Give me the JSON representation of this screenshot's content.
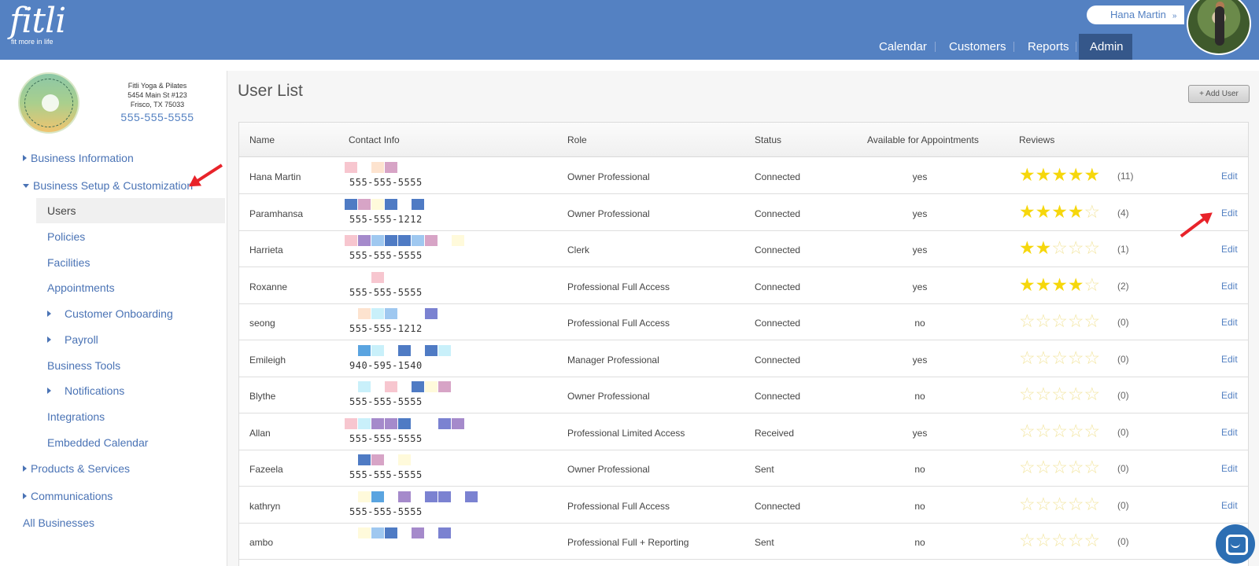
{
  "brand": {
    "name": "fitli",
    "tagline": "fit more in life"
  },
  "header": {
    "user_name": "Hana Martin",
    "user_chevron": "»",
    "nav": [
      "Calendar",
      "Customers",
      "Reports",
      "Admin"
    ],
    "active_nav": "Admin"
  },
  "business": {
    "name": "Fitli Yoga & Pilates",
    "address1": "5454 Main St #123",
    "address2": "Frisco, TX 75033",
    "phone": "555-555-5555"
  },
  "sidebar": {
    "business_information": "Business Information",
    "business_setup": "Business Setup & Customization",
    "sub_items": {
      "users": "Users",
      "policies": "Policies",
      "facilities": "Facilities",
      "appointments": "Appointments",
      "customer_onboarding": "Customer Onboarding",
      "payroll": "Payroll",
      "business_tools": "Business Tools",
      "notifications": "Notifications",
      "integrations": "Integrations",
      "embedded_calendar": "Embedded Calendar"
    },
    "products_services": "Products & Services",
    "communications": "Communications",
    "all_businesses": "All Businesses",
    "selected": "Users"
  },
  "main": {
    "title": "User List",
    "add_user_label": "+ Add User",
    "columns": [
      "Name",
      "Contact Info",
      "Role",
      "Status",
      "Available for Appointments",
      "Reviews"
    ],
    "edit_label": "Edit",
    "rows": [
      {
        "name": "Hana Martin",
        "phone": "555-555-5555",
        "role": "Owner Professional",
        "status": "Connected",
        "available": "yes",
        "stars": 5,
        "count": "(11)"
      },
      {
        "name": "Paramhansa",
        "phone": "555-555-1212",
        "role": "Owner Professional",
        "status": "Connected",
        "available": "yes",
        "stars": 4,
        "count": "(4)"
      },
      {
        "name": "Harrieta",
        "phone": "555-555-5555",
        "role": "Clerk",
        "status": "Connected",
        "available": "yes",
        "stars": 2,
        "count": "(1)"
      },
      {
        "name": "Roxanne",
        "phone": "555-555-5555",
        "role": "Professional Full Access",
        "status": "Connected",
        "available": "yes",
        "stars": 4,
        "count": "(2)"
      },
      {
        "name": "seong",
        "phone": "555-555-1212",
        "role": "Professional Full Access",
        "status": "Connected",
        "available": "no",
        "stars": 0,
        "count": "(0)"
      },
      {
        "name": "Emileigh",
        "phone": "940-595-1540",
        "role": "Manager Professional",
        "status": "Connected",
        "available": "yes",
        "stars": 0,
        "count": "(0)"
      },
      {
        "name": "Blythe",
        "phone": "555-555-5555",
        "role": "Owner Professional",
        "status": "Connected",
        "available": "no",
        "stars": 0,
        "count": "(0)"
      },
      {
        "name": "Allan",
        "phone": "555-555-5555",
        "role": "Professional Limited Access",
        "status": "Received",
        "available": "yes",
        "stars": 0,
        "count": "(0)"
      },
      {
        "name": "Fazeela",
        "phone": "555-555-5555",
        "role": "Owner Professional",
        "status": "Sent",
        "available": "no",
        "stars": 0,
        "count": "(0)"
      },
      {
        "name": "kathryn",
        "phone": "555-555-5555",
        "role": "Professional Full Access",
        "status": "Connected",
        "available": "no",
        "stars": 0,
        "count": "(0)"
      },
      {
        "name": "ambo",
        "phone": "",
        "role": "Professional Full + Reporting",
        "status": "Sent",
        "available": "no",
        "stars": 0,
        "count": "(0)"
      }
    ]
  },
  "colors": {
    "brand_blue": "#5481c2",
    "active_tab": "#35578a",
    "star_on": "#f6d70c",
    "star_off": "#f3e6a2",
    "arrow_red": "#e8232a",
    "redact_palette": [
      "#f7c6cf",
      "#d7a4c6",
      "#4f7bc4",
      "#fde3cf",
      "#9fc8f0",
      "#c9f0fa",
      "#7b82d1",
      "#a58acb",
      "#fffadb",
      "#5aa4e0"
    ]
  },
  "icons": {
    "user_menu_chevron": "chevron-down-icon",
    "expand": "triangle-right-icon",
    "collapse": "triangle-down-icon",
    "star": "star-icon",
    "chat": "chat-icon"
  }
}
